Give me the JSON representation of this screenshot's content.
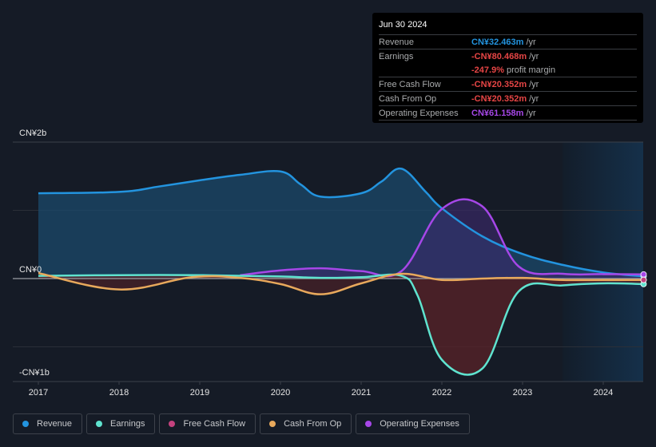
{
  "tooltip": {
    "date": "Jun 30 2024",
    "rows": [
      {
        "label": "Revenue",
        "value": "CN¥32.463m",
        "unit": "/yr",
        "color": "#2394df"
      },
      {
        "label": "Earnings",
        "value": "-CN¥80.468m",
        "unit": "/yr",
        "color": "#e64545"
      },
      {
        "label": "",
        "value": "-247.9%",
        "unit": "profit margin",
        "color": "#e64545"
      },
      {
        "label": "Free Cash Flow",
        "value": "-CN¥20.352m",
        "unit": "/yr",
        "color": "#e64545"
      },
      {
        "label": "Cash From Op",
        "value": "-CN¥20.352m",
        "unit": "/yr",
        "color": "#e64545"
      },
      {
        "label": "Operating Expenses",
        "value": "CN¥61.158m",
        "unit": "/yr",
        "color": "#a647e8"
      }
    ]
  },
  "legend": [
    {
      "label": "Revenue",
      "color": "#2394df"
    },
    {
      "label": "Earnings",
      "color": "#5fe3cf"
    },
    {
      "label": "Free Cash Flow",
      "color": "#c4427e"
    },
    {
      "label": "Cash From Op",
      "color": "#e8a95c"
    },
    {
      "label": "Operating Expenses",
      "color": "#a647e8"
    }
  ],
  "chart_data": {
    "type": "line",
    "title": "",
    "xlabel": "",
    "ylabel": "",
    "unit": "CN¥ billions",
    "ylim": [
      -1.5,
      2.0
    ],
    "xlim": [
      2016.7,
      2024.5
    ],
    "y_ticks": [
      {
        "value": 2,
        "label": "CN¥2b"
      },
      {
        "value": 0,
        "label": "CN¥0"
      },
      {
        "value": -1,
        "label": "-CN¥1b"
      }
    ],
    "x_ticks": [
      2017,
      2018,
      2019,
      2020,
      2021,
      2022,
      2023,
      2024
    ],
    "grid": true,
    "forecast_shade_start": 2023.5,
    "legend_position": "bottom",
    "series": [
      {
        "name": "Revenue",
        "color": "#2394df",
        "fill": true,
        "x": [
          2017.0,
          2018.0,
          2018.5,
          2019.0,
          2019.5,
          2020.0,
          2020.25,
          2020.5,
          2021.0,
          2021.25,
          2021.5,
          2021.8,
          2022.0,
          2022.5,
          2023.0,
          2023.5,
          2024.0,
          2024.5
        ],
        "y": [
          1.25,
          1.27,
          1.35,
          1.44,
          1.52,
          1.57,
          1.38,
          1.2,
          1.25,
          1.42,
          1.61,
          1.27,
          1.03,
          0.62,
          0.36,
          0.2,
          0.09,
          0.032
        ]
      },
      {
        "name": "Earnings",
        "color": "#5fe3cf",
        "fill": true,
        "x": [
          2017.0,
          2018.0,
          2019.0,
          2020.0,
          2020.5,
          2021.0,
          2021.5,
          2021.7,
          2022.0,
          2022.5,
          2022.95,
          2023.5,
          2024.0,
          2024.5
        ],
        "y": [
          0.04,
          0.05,
          0.05,
          0.03,
          0.01,
          0.02,
          0.04,
          -0.25,
          -1.19,
          -1.32,
          -0.19,
          -0.1,
          -0.07,
          -0.08
        ]
      },
      {
        "name": "Free Cash Flow",
        "color": "#c4427e",
        "fill": false,
        "x": [
          2024.5
        ],
        "y": [
          -0.02
        ]
      },
      {
        "name": "Cash From Op",
        "color": "#e8a95c",
        "fill": true,
        "x": [
          2017.0,
          2018.0,
          2018.9,
          2019.5,
          2020.0,
          2020.5,
          2021.0,
          2021.5,
          2022.0,
          2022.5,
          2023.0,
          2023.5,
          2024.0,
          2024.5
        ],
        "y": [
          0.08,
          -0.16,
          0.02,
          0.01,
          -0.08,
          -0.23,
          -0.07,
          0.07,
          -0.02,
          0.0,
          0.01,
          -0.02,
          -0.02,
          -0.02
        ]
      },
      {
        "name": "Operating Expenses",
        "color": "#a647e8",
        "fill": true,
        "x": [
          2019.5,
          2020.0,
          2020.5,
          2021.0,
          2021.5,
          2022.0,
          2022.5,
          2022.95,
          2023.5,
          2024.0,
          2024.5
        ],
        "y": [
          0.05,
          0.12,
          0.15,
          0.11,
          0.11,
          1.02,
          1.06,
          0.18,
          0.07,
          0.065,
          0.061
        ]
      }
    ]
  }
}
